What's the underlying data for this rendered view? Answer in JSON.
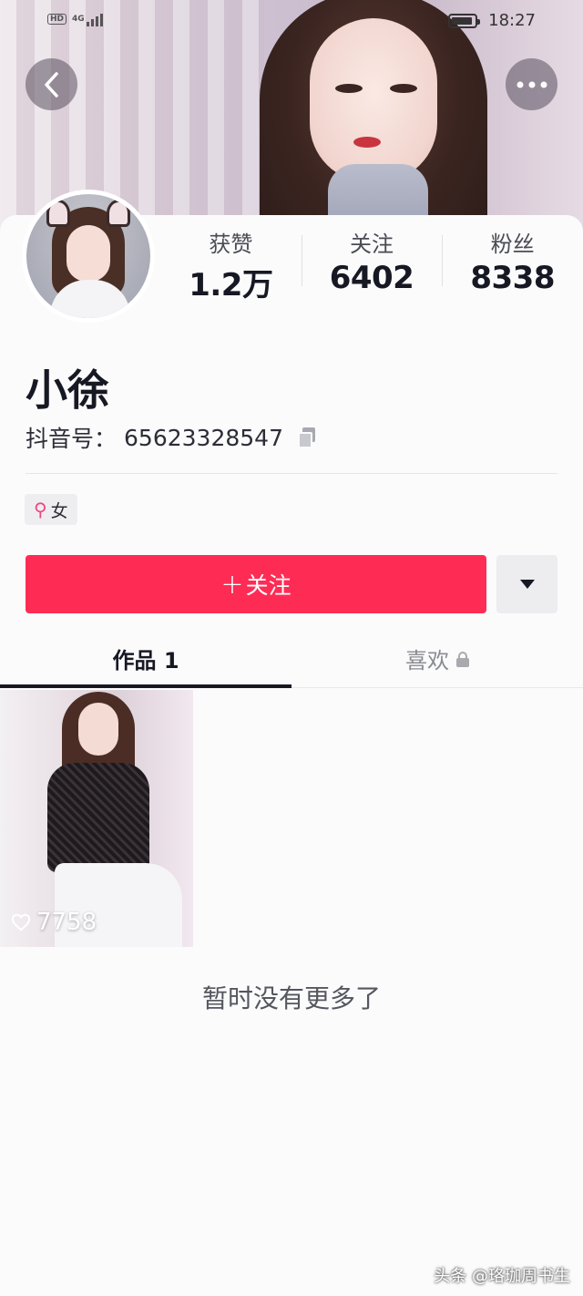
{
  "status_bar": {
    "badge": "HD",
    "network": "4G",
    "time": "18:27",
    "battery_level": 0.9
  },
  "nav": {
    "back_icon": "chevron-left-icon",
    "more_icon": "more-dots-icon"
  },
  "stats": [
    {
      "label": "获赞",
      "value": "1.2万"
    },
    {
      "label": "关注",
      "value": "6402"
    },
    {
      "label": "粉丝",
      "value": "8338"
    }
  ],
  "profile": {
    "name": "小徐",
    "id_label": "抖音号：",
    "id_value": "65623328547",
    "gender_symbol": "⚲",
    "gender": "女"
  },
  "actions": {
    "follow_label": "关注",
    "follow_plus": "+"
  },
  "tabs": [
    {
      "label": "作品 1",
      "active": true
    },
    {
      "label": "喜欢",
      "active": false,
      "locked": true
    }
  ],
  "videos": [
    {
      "likes": "7758"
    }
  ],
  "empty_note": "暂时没有更多了",
  "watermark": "头条 @珞珈周书生",
  "colors": {
    "accent": "#fe2c55",
    "female": "#f1467a",
    "text": "#161823"
  }
}
